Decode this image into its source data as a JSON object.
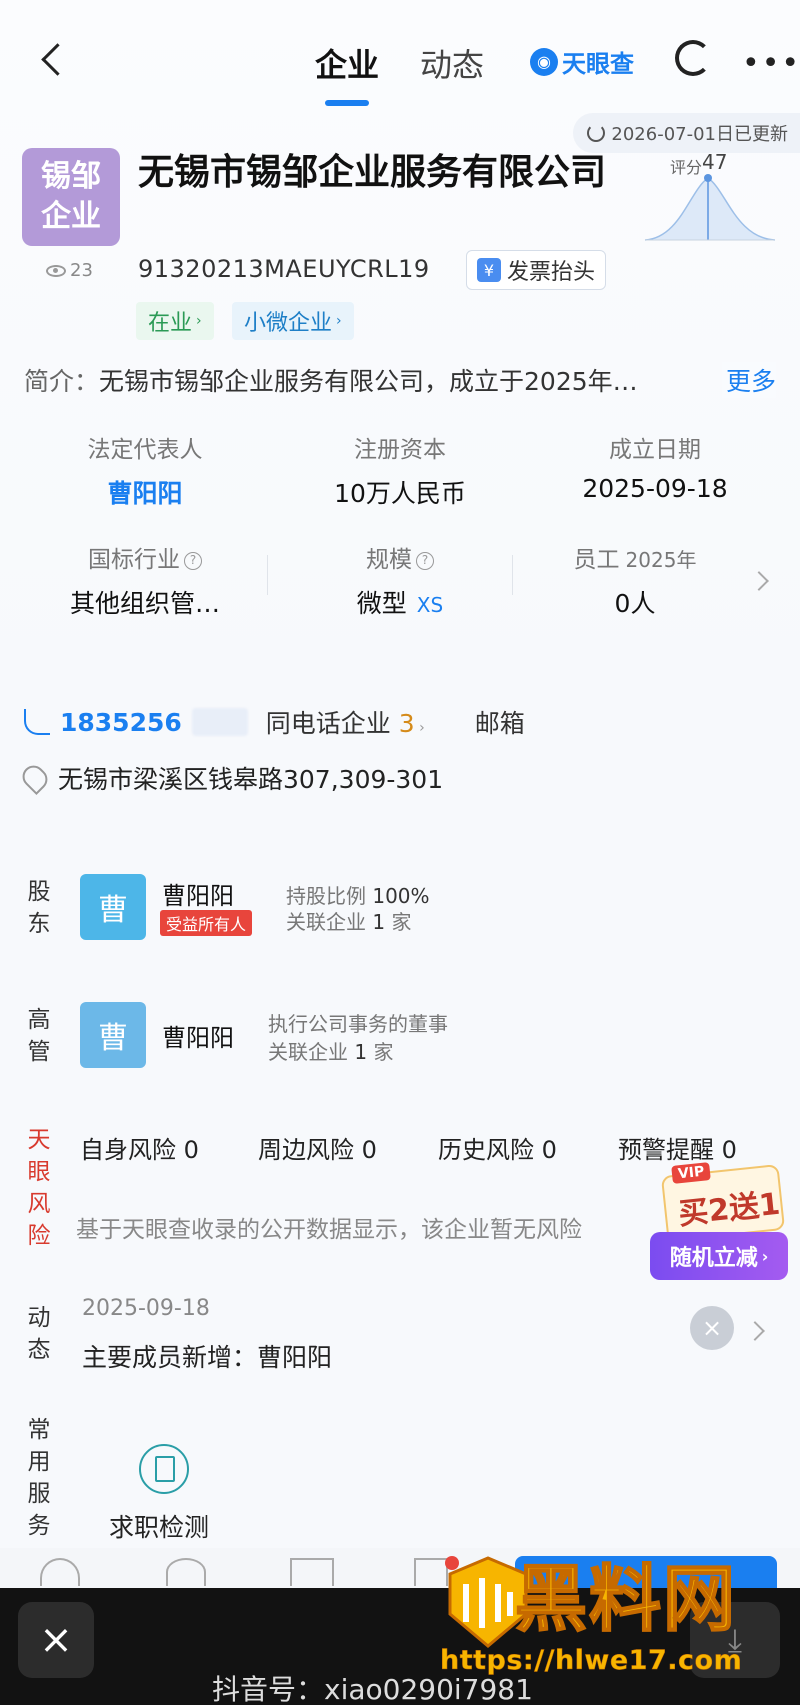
{
  "header": {
    "tabs": [
      {
        "label": "企业"
      },
      {
        "label": "动态"
      }
    ],
    "brand": "天眼查",
    "updated": "2026-07-01日已更新"
  },
  "company": {
    "logo_text": "锡邹\n企业",
    "logo_line1": "锡邹",
    "logo_line2": "企业",
    "name": "无锡市锡邹企业服务有限公司",
    "views": "23",
    "credit_code": "91320213MAEUYCRL19",
    "invoice_button": "发票抬头",
    "tags": [
      {
        "label": "在业"
      },
      {
        "label": "小微企业"
      }
    ],
    "score_label": "评分",
    "score_value": "47",
    "score": 47
  },
  "intro": {
    "label": "简介：",
    "text": "无锡市锡邹企业服务有限公司，成立于2025年…",
    "more": "更多"
  },
  "key_info": {
    "legal_rep": {
      "label": "法定代表人",
      "value": "曹阳阳"
    },
    "capital": {
      "label": "注册资本",
      "value": "10万人民币"
    },
    "founded": {
      "label": "成立日期",
      "value": "2025-09-18"
    },
    "industry": {
      "label": "国标行业",
      "value": "其他组织管…"
    },
    "scale": {
      "label": "规模",
      "value": "微型",
      "tag": "XS"
    },
    "staff": {
      "label": "员工",
      "year": "2025年",
      "value": "0人"
    }
  },
  "contact": {
    "phone": "1835256",
    "same_phone_label": "同电话企业",
    "same_phone_count": "3",
    "email_label": "邮箱",
    "address": "无锡市梁溪区钱皋路307,309-301"
  },
  "shareholder": {
    "section_label": "股东",
    "avatar": "曹",
    "name": "曹阳阳",
    "badge": "受益所有人",
    "ratio_label": "持股比例",
    "ratio_value": "100%",
    "related_label": "关联企业",
    "related_value": "1",
    "related_unit": "家"
  },
  "executive": {
    "section_label": "高管",
    "avatar": "曹",
    "name": "曹阳阳",
    "role": "执行公司事务的董事",
    "related_label": "关联企业",
    "related_value": "1",
    "related_unit": "家"
  },
  "risk": {
    "section_label": "天眼风险",
    "items": [
      {
        "label": "自身风险",
        "value": "0"
      },
      {
        "label": "周边风险",
        "value": "0"
      },
      {
        "label": "历史风险",
        "value": "0"
      },
      {
        "label": "预警提醒",
        "value": "0"
      }
    ],
    "note": "基于天眼查收录的公开数据显示，该企业暂无风险"
  },
  "promo": {
    "vip": "VIP",
    "text": "买2送1",
    "button": "随机立减"
  },
  "news": {
    "section_label": "动态",
    "date": "2025-09-18",
    "text": "主要成员新增：曹阳阳"
  },
  "services": {
    "section_label": "常用服务",
    "items": [
      {
        "label": "求职检测"
      }
    ]
  },
  "overlay": {
    "close": "×",
    "watermark_title": "黑料网",
    "watermark_url": "https://hlwe17.com",
    "douyin_id": "抖音号：xiao0290i7981"
  },
  "colors": {
    "accent": "#1a7ff0",
    "risk": "#d83a2e",
    "logo": "#b39ad8"
  }
}
